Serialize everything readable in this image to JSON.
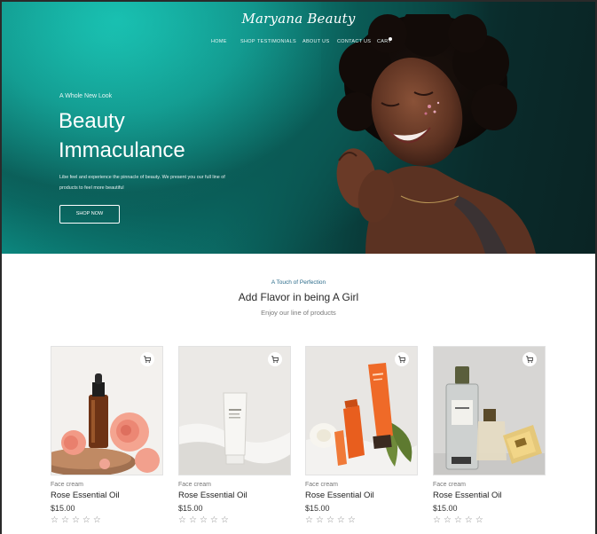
{
  "brand": "Maryana Beauty",
  "nav": {
    "items": [
      "HOME",
      "SHOP",
      "TESTIMONIALS",
      "ABOUT US",
      "CONTACT US",
      "CART"
    ]
  },
  "hero": {
    "eyebrow": "A Whole  New Look",
    "headline_line1": "Beauty",
    "headline_line2": "Immaculance",
    "subtext": "Libe feel and experience the pinnacle of beauty. We present you our full line of products to feel more beautiful",
    "cta": "SHOP NOW"
  },
  "products_section": {
    "eyebrow": "A Touch of Perfection",
    "title": "Add Flavor in being A Girl",
    "subtitle": "Enjoy our line of products"
  },
  "products": [
    {
      "category": "Face cream",
      "name": "Rose Essential Oil",
      "price": "$15.00",
      "rating": 0
    },
    {
      "category": "Face cream",
      "name": "Rose Essential Oil",
      "price": "$15.00",
      "rating": 0
    },
    {
      "category": "Face cream",
      "name": "Rose Essential Oil",
      "price": "$15.00",
      "rating": 0
    },
    {
      "category": "Face cream",
      "name": "Rose Essential Oil",
      "price": "$15.00",
      "rating": 0
    }
  ],
  "colors": {
    "hero_teal": "#12b3a6",
    "hero_dark": "#0a2424",
    "accent_blue": "#2b6b8a"
  }
}
